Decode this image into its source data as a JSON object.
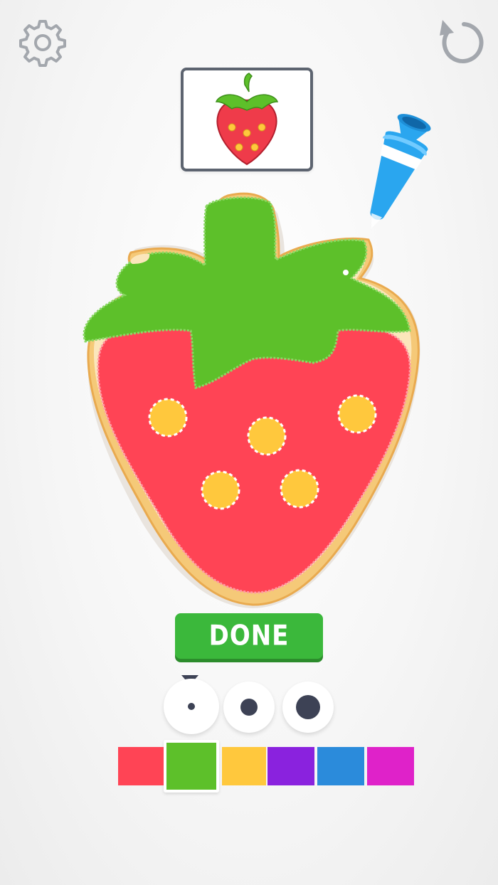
{
  "hud": {
    "settings_icon": "gear-icon",
    "restart_icon": "restart-icon"
  },
  "target": {
    "image": "strawberry",
    "icon": "strawberry-icon"
  },
  "done_button": {
    "label": "DONE"
  },
  "brush_sizes": {
    "items": [
      "small",
      "medium",
      "large"
    ],
    "selected": "small"
  },
  "palette": {
    "colors": [
      "#ff4455",
      "#5dc02a",
      "#ffc83d",
      "#8a22de",
      "#2b8bdb",
      "#df22c9"
    ],
    "selected_index": 1
  },
  "colors": {
    "accent_green": "#3bb83b",
    "icon_gray": "#9aa0a8",
    "dark": "#3d4255"
  }
}
